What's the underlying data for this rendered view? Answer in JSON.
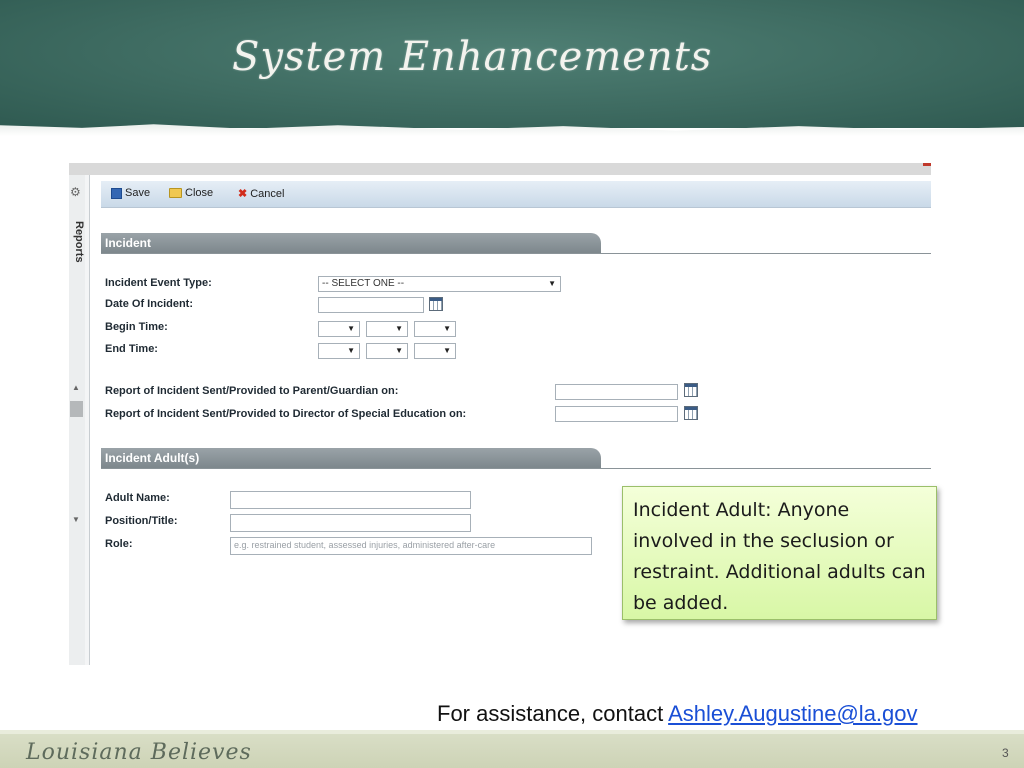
{
  "slide": {
    "title": "System Enhancements",
    "page_number": "3",
    "footer_brand": "Louisiana Believes",
    "assistance_text": "For assistance, contact ",
    "assistance_email": "Ashley.Augustine@la.gov"
  },
  "sidebar": {
    "reports_label": "Reports"
  },
  "toolbar": {
    "save_label": "Save",
    "close_label": "Close",
    "cancel_label": "Cancel"
  },
  "incident": {
    "section_title": "Incident",
    "event_type_label": "Incident Event Type:",
    "event_type_value": "-- SELECT ONE --",
    "date_label": "Date Of Incident:",
    "begin_time_label": "Begin Time:",
    "end_time_label": "End Time:",
    "report_parent_label": "Report of Incident Sent/Provided to Parent/Guardian on:",
    "report_director_label": "Report of Incident Sent/Provided to Director of Special Education on:"
  },
  "incident_adults": {
    "section_title": "Incident Adult(s)",
    "adult_name_label": "Adult Name:",
    "position_label": "Position/Title:",
    "role_label": "Role:",
    "role_placeholder": "e.g. restrained student, assessed injuries, administered after-care"
  },
  "callout": {
    "text": "Incident Adult: Anyone involved in the seclusion or restraint. Additional adults can be added."
  },
  "icons": {
    "save": "save-icon",
    "close": "folder-icon",
    "cancel": "cancel-x-icon",
    "calendar": "calendar-icon",
    "dropdown": "dropdown-arrow-icon"
  },
  "colors": {
    "chalkboard": "#3e6b61",
    "section_bar": "#8a9398",
    "callout_bg": "#e2f9b8",
    "link": "#1a4fd6"
  }
}
